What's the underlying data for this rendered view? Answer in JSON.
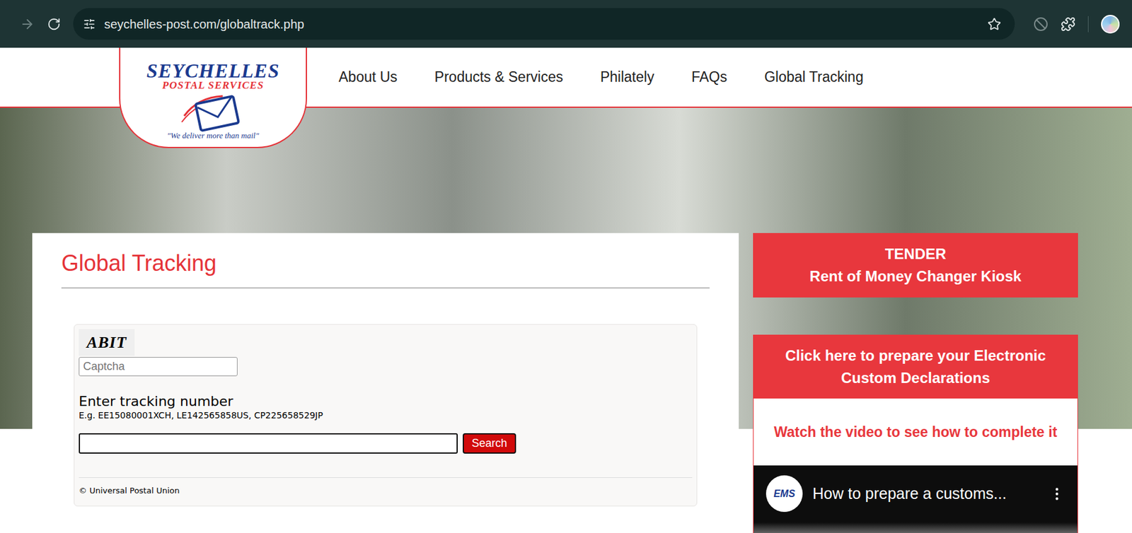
{
  "browser": {
    "url": "seychelles-post.com/globaltrack.php",
    "forward_disabled": true
  },
  "logo": {
    "name": "SEYCHELLES",
    "subtitle": "POSTAL SERVICES",
    "tagline": "\"We deliver more than mail\""
  },
  "nav": [
    "About Us",
    "Products & Services",
    "Philately",
    "FAQs",
    "Global Tracking"
  ],
  "page": {
    "title": "Global Tracking"
  },
  "tracking": {
    "captcha_image": "ABIT",
    "captcha_placeholder": "Captcha",
    "label": "Enter tracking number",
    "example": "E.g. EE15080001XCH, LE142565858US, CP225658529JP",
    "value": "",
    "button": "Search",
    "footer": "© Universal Postal Union"
  },
  "sidebar": {
    "tender": {
      "title": "TENDER",
      "subtitle": "Rent of Money Changer Kiosk"
    },
    "declarations": "Click here to prepare your Electronic Custom Declarations",
    "video_link": "Watch the video to see how to complete it",
    "video": {
      "channel": "EMS",
      "title": "How to prepare a customs..."
    }
  }
}
